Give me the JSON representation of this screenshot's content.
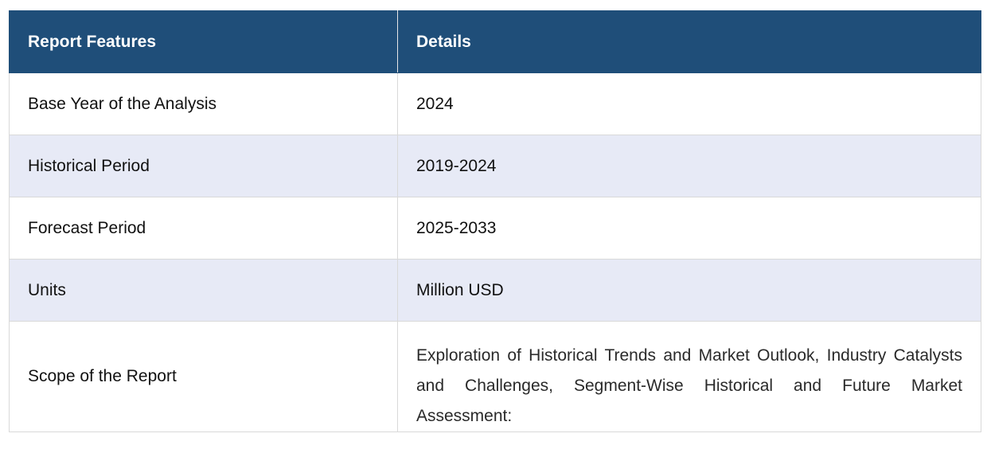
{
  "table": {
    "headers": {
      "feature": "Report Features",
      "detail": "Details"
    },
    "rows": [
      {
        "feature": "Base Year of the Analysis",
        "detail": "2024"
      },
      {
        "feature": "Historical Period",
        "detail": "2019-2024"
      },
      {
        "feature": "Forecast Period",
        "detail": "2025-2033"
      },
      {
        "feature": "Units",
        "detail": "Million USD"
      },
      {
        "feature": "Scope of the Report",
        "detail": "Exploration of Historical Trends and Market Outlook, Industry Catalysts and Challenges, Segment-Wise Historical and Future Market Assessment:"
      }
    ]
  },
  "colors": {
    "header_background": "#1f4e79",
    "header_text": "#ffffff",
    "shaded_row": "#e7eaf6",
    "border": "#d9d9d9"
  }
}
